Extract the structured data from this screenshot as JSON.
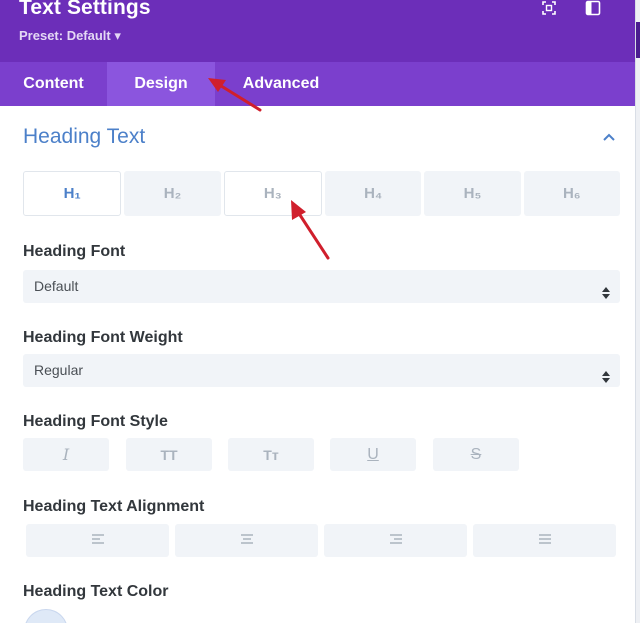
{
  "header": {
    "title": "Text Settings",
    "preset": "Preset: Default ▾",
    "icons": [
      "expand-icon",
      "sidebar-toggle-icon"
    ]
  },
  "tabs": [
    {
      "label": "Content"
    },
    {
      "label": "Design",
      "active": true
    },
    {
      "label": "Advanced"
    }
  ],
  "section": {
    "title": "Heading Text",
    "heading_levels": [
      "H₁",
      "H₂",
      "H₃",
      "H₄",
      "H₅",
      "H₆"
    ],
    "selected_level": "H₁"
  },
  "fields": {
    "font_label": "Heading Font",
    "font_value": "Default",
    "weight_label": "Heading Font Weight",
    "weight_value": "Regular",
    "style_label": "Heading Font Style",
    "styles": [
      "I",
      "TT",
      "Tт",
      "U",
      "S"
    ],
    "alignment_label": "Heading Text Alignment",
    "alignments": [
      "align-left-icon",
      "align-center-icon",
      "align-right-icon",
      "align-justify-icon"
    ],
    "color_label": "Heading Text Color"
  },
  "colors": {
    "header_bg": "#6c2eb9",
    "tabs_bg": "#7b3fcd",
    "active_tab_bg": "#8b55de",
    "section_title": "#4c80c9",
    "annotation_arrow": "#d01f2c"
  }
}
